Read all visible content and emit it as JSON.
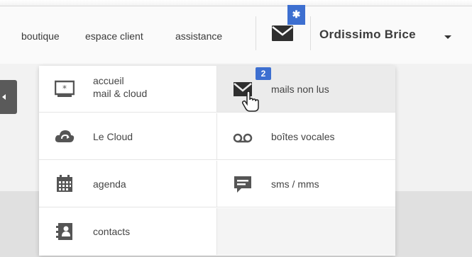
{
  "header": {
    "links": [
      "boutique",
      "espace client",
      "assistance"
    ],
    "mail_badge": "✱",
    "user_name": "Ordissimo Brice"
  },
  "menu": {
    "left": [
      {
        "label_line1": "accueil",
        "label_line2": "mail & cloud",
        "icon": "home-screen-icon"
      },
      {
        "label": "Le Cloud",
        "icon": "cloud-icon"
      },
      {
        "label": "agenda",
        "icon": "calendar-icon"
      },
      {
        "label": "contacts",
        "icon": "contacts-book-icon"
      }
    ],
    "right": [
      {
        "label": "mails non lus",
        "icon": "envelope-icon",
        "badge": "2"
      },
      {
        "label": "boîtes vocales",
        "icon": "voicemail-icon"
      },
      {
        "label": "sms / mms",
        "icon": "chat-bubble-icon"
      }
    ]
  },
  "colors": {
    "accent": "#3d6fd0",
    "hover": "#ebebeb",
    "icon": "#555555"
  }
}
